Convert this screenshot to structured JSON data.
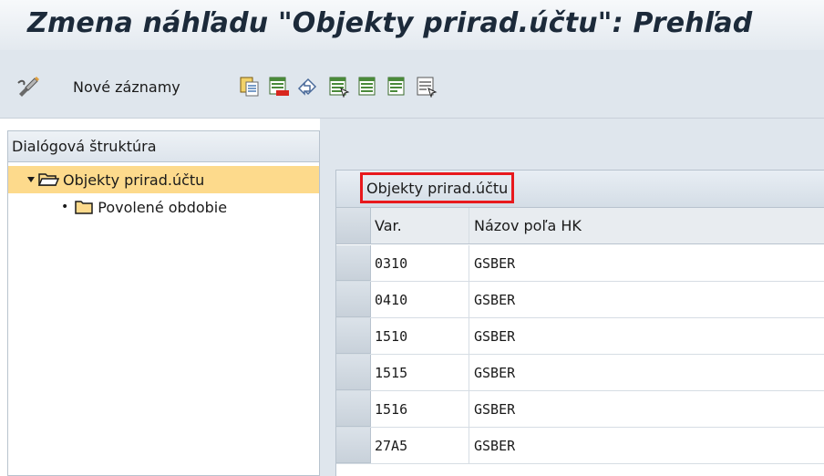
{
  "window": {
    "title": "Zmena náhľadu \"Objekty prirad.účtu\": Prehľad"
  },
  "toolbar": {
    "new_entries_label": "Nové záznamy",
    "icons": [
      "display-change-icon",
      "copy-icon",
      "delete-icon",
      "undo-icon",
      "select-all-icon",
      "select-block-icon",
      "deselect-all-icon",
      "config-icon"
    ]
  },
  "nav": {
    "header": "Dialógová štruktúra",
    "items": [
      {
        "label": "Objekty prirad.účtu",
        "selected": true,
        "expanded": true
      },
      {
        "label": "Povolené obdobie",
        "selected": false
      }
    ]
  },
  "table": {
    "title": "Objekty prirad.účtu",
    "columns": [
      "Var.",
      "Názov poľa HK"
    ],
    "rows": [
      [
        "0310",
        "GSBER"
      ],
      [
        "0410",
        "GSBER"
      ],
      [
        "1510",
        "GSBER"
      ],
      [
        "1515",
        "GSBER"
      ],
      [
        "1516",
        "GSBER"
      ],
      [
        "27A5",
        "GSBER"
      ]
    ]
  },
  "colors": {
    "highlight_border": "#e8191d",
    "selected_tree_item": "#fdda8c",
    "toolbar_bg": "#dfe6ed"
  }
}
